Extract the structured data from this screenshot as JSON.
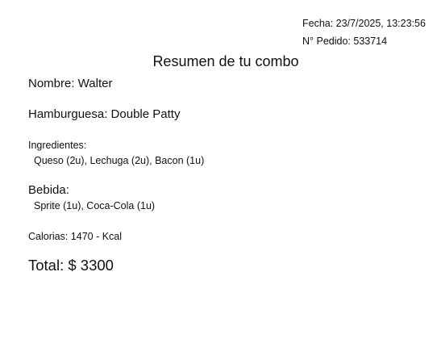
{
  "header": {
    "fecha": "Fecha: 23/7/2025, 13:23:56",
    "pedido": "N° Pedido: 533714"
  },
  "title": "Resumen de tu combo",
  "nombre": "Nombre: Walter",
  "hamburguesa": "Hamburguesa: Double Patty",
  "ingredientes": {
    "label": "Ingredientes:",
    "value": "Queso (2u), Lechuga (2u), Bacon (1u)"
  },
  "bebida": {
    "label": "Bebida:",
    "value": "Sprite (1u), Coca-Cola (1u)"
  },
  "calorias": "Calorias: 1470 - Kcal",
  "total": "Total: $ 3300"
}
